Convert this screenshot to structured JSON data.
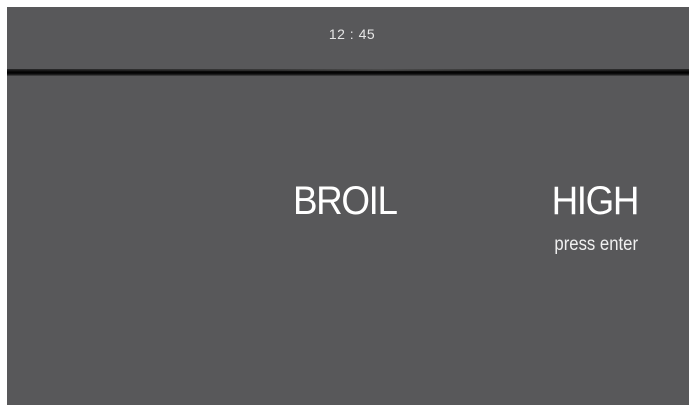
{
  "status_bar": {
    "clock": "12 : 45"
  },
  "main": {
    "mode": "BROIL",
    "level": "HIGH",
    "hint": "press enter"
  },
  "colors": {
    "screen_background": "#58585a",
    "text": "#ffffff",
    "divider": "#000000"
  }
}
